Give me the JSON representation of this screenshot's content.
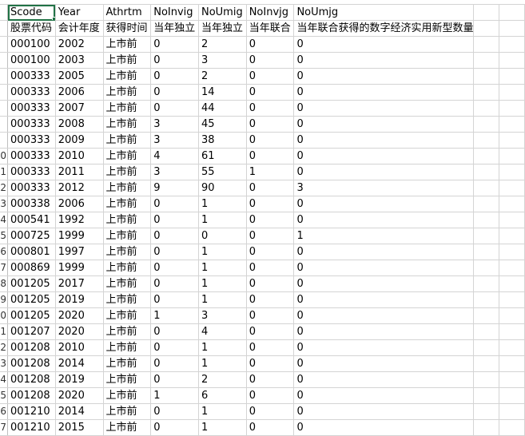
{
  "sheet": {
    "columns": [
      "Scode",
      "Year",
      "Athrtm",
      "NoInvig",
      "NoUmig",
      "NoInvjg",
      "NoUmjg"
    ],
    "descriptions": [
      "股票代码",
      "会计年度",
      "获得时间",
      "当年独立",
      "当年独立",
      "当年联合",
      "当年联合获得的数字经济实用新型数量"
    ],
    "rows": [
      {
        "num": "",
        "cells": [
          "000100",
          "2002",
          "上市前",
          "0",
          "2",
          "0",
          "0"
        ]
      },
      {
        "num": "",
        "cells": [
          "000100",
          "2003",
          "上市前",
          "0",
          "3",
          "0",
          "0"
        ]
      },
      {
        "num": "",
        "cells": [
          "000333",
          "2005",
          "上市前",
          "0",
          "2",
          "0",
          "0"
        ]
      },
      {
        "num": "",
        "cells": [
          "000333",
          "2006",
          "上市前",
          "0",
          "14",
          "0",
          "0"
        ]
      },
      {
        "num": "",
        "cells": [
          "000333",
          "2007",
          "上市前",
          "0",
          "44",
          "0",
          "0"
        ]
      },
      {
        "num": "",
        "cells": [
          "000333",
          "2008",
          "上市前",
          "3",
          "45",
          "0",
          "0"
        ]
      },
      {
        "num": "",
        "cells": [
          "000333",
          "2009",
          "上市前",
          "3",
          "38",
          "0",
          "0"
        ]
      },
      {
        "num": "0",
        "cells": [
          "000333",
          "2010",
          "上市前",
          "4",
          "61",
          "0",
          "0"
        ]
      },
      {
        "num": "1",
        "cells": [
          "000333",
          "2011",
          "上市前",
          "3",
          "55",
          "1",
          "0"
        ]
      },
      {
        "num": "2",
        "cells": [
          "000333",
          "2012",
          "上市前",
          "9",
          "90",
          "0",
          "3"
        ]
      },
      {
        "num": "3",
        "cells": [
          "000338",
          "2006",
          "上市前",
          "0",
          "1",
          "0",
          "0"
        ]
      },
      {
        "num": "4",
        "cells": [
          "000541",
          "1992",
          "上市前",
          "0",
          "1",
          "0",
          "0"
        ]
      },
      {
        "num": "5",
        "cells": [
          "000725",
          "1999",
          "上市前",
          "0",
          "0",
          "0",
          "1"
        ]
      },
      {
        "num": "6",
        "cells": [
          "000801",
          "1997",
          "上市前",
          "0",
          "1",
          "0",
          "0"
        ]
      },
      {
        "num": "7",
        "cells": [
          "000869",
          "1999",
          "上市前",
          "0",
          "1",
          "0",
          "0"
        ]
      },
      {
        "num": "8",
        "cells": [
          "001205",
          "2017",
          "上市前",
          "0",
          "1",
          "0",
          "0"
        ]
      },
      {
        "num": "9",
        "cells": [
          "001205",
          "2019",
          "上市前",
          "0",
          "1",
          "0",
          "0"
        ]
      },
      {
        "num": "0",
        "cells": [
          "001205",
          "2020",
          "上市前",
          "1",
          "3",
          "0",
          "0"
        ]
      },
      {
        "num": "1",
        "cells": [
          "001207",
          "2020",
          "上市前",
          "0",
          "4",
          "0",
          "0"
        ]
      },
      {
        "num": "2",
        "cells": [
          "001208",
          "2010",
          "上市前",
          "0",
          "1",
          "0",
          "0"
        ]
      },
      {
        "num": "3",
        "cells": [
          "001208",
          "2014",
          "上市前",
          "0",
          "1",
          "0",
          "0"
        ]
      },
      {
        "num": "4",
        "cells": [
          "001208",
          "2019",
          "上市前",
          "0",
          "2",
          "0",
          "0"
        ]
      },
      {
        "num": "5",
        "cells": [
          "001208",
          "2020",
          "上市前",
          "1",
          "6",
          "0",
          "0"
        ]
      },
      {
        "num": "6",
        "cells": [
          "001210",
          "2014",
          "上市前",
          "0",
          "1",
          "0",
          "0"
        ]
      },
      {
        "num": "7",
        "cells": [
          "001210",
          "2015",
          "上市前",
          "0",
          "1",
          "0",
          "0"
        ]
      }
    ]
  }
}
